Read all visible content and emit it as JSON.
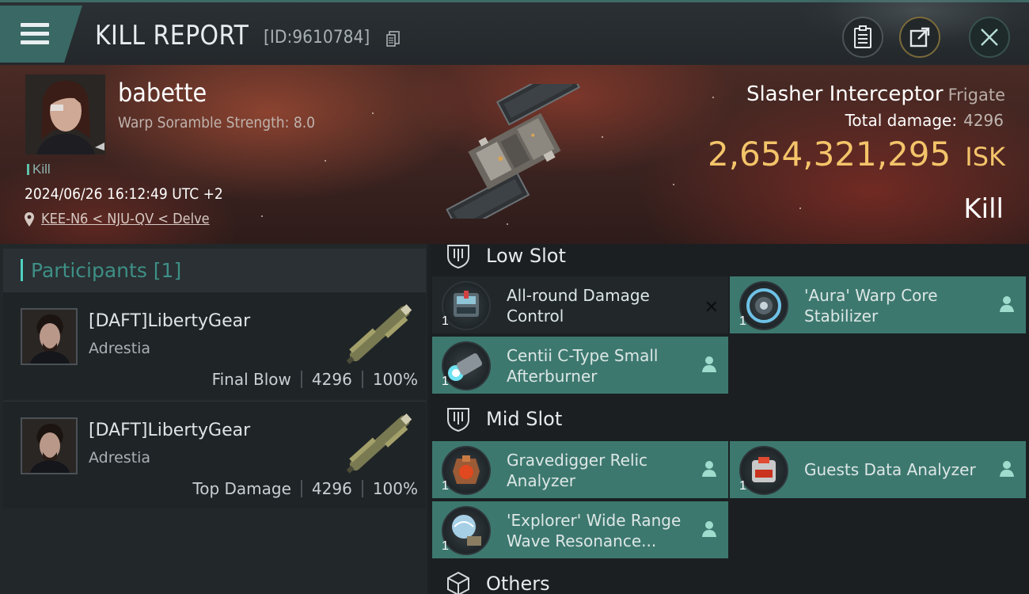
{
  "header": {
    "title": "KILL REPORT",
    "report_id": "[ID:9610784]",
    "icons": [
      "menu-icon",
      "copy-icon",
      "clipboard-icon",
      "share-icon",
      "close-icon"
    ]
  },
  "victim": {
    "name": "babette",
    "subtitle": "Warp Soramble Strength: 8.0",
    "tag": "Kill",
    "datetime": "2024/06/26 16:12:49 UTC +2",
    "location": "KEE-N6 < NJU-QV < Delve",
    "ship_name": "Slasher Interceptor",
    "ship_class": "Frigate",
    "total_damage_label": "Total damage:",
    "total_damage": "4296",
    "isk_value": "2,654,321,295",
    "isk_unit": "ISK",
    "result": "Kill"
  },
  "participants": {
    "header": "Participants [1]",
    "rows": [
      {
        "name": "[DAFT]LibertyGear",
        "corp": "Adrestia",
        "role": "Final Blow",
        "damage": "4296",
        "percent": "100%"
      },
      {
        "name": "[DAFT]LibertyGear",
        "corp": "Adrestia",
        "role": "Top Damage",
        "damage": "4296",
        "percent": "100%"
      }
    ]
  },
  "slots": {
    "low": {
      "title": "Low Slot",
      "items": [
        {
          "qty": "1",
          "name": "All-round Damage Control",
          "state": "destroyed"
        },
        {
          "qty": "1",
          "name": "'Aura' Warp Core Stabilizer",
          "state": "dropped"
        },
        {
          "qty": "1",
          "name": "Centii C-Type Small Afterburner",
          "state": "dropped"
        }
      ]
    },
    "mid": {
      "title": "Mid Slot",
      "items": [
        {
          "qty": "1",
          "name": "Gravedigger Relic Analyzer",
          "state": "dropped"
        },
        {
          "qty": "1",
          "name": "Guests Data Analyzer",
          "state": "dropped"
        },
        {
          "qty": "1",
          "name": "'Explorer' Wide Range Wave Resonance...",
          "state": "dropped"
        }
      ]
    },
    "others": {
      "title": "Others"
    }
  },
  "colors": {
    "accent": "#3d786f",
    "isk": "#f4c46a",
    "participants_header": "#3e8f86"
  }
}
